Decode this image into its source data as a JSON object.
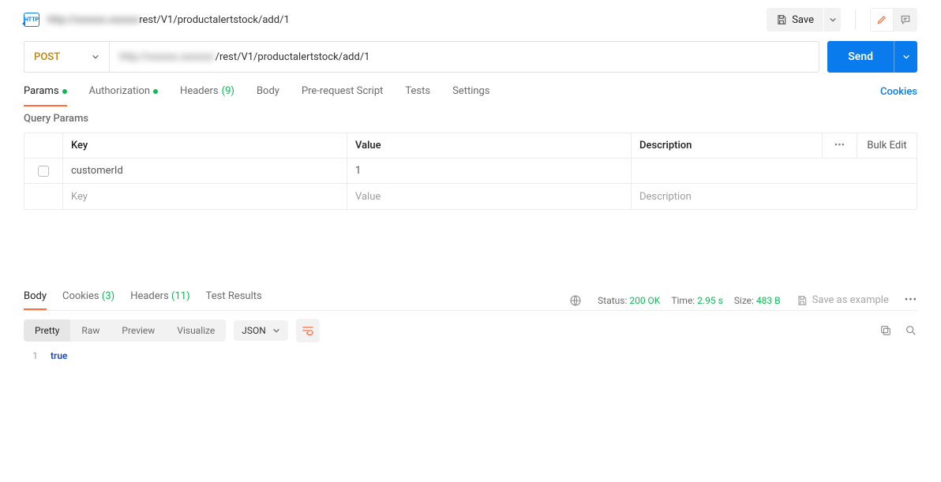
{
  "tab": {
    "badge": "HTTP",
    "host": "http://xxxxxx.xxxxxx",
    "path": "rest/V1/productalertstock/add/1"
  },
  "toolbar": {
    "save_label": "Save"
  },
  "request": {
    "method": "POST",
    "url_host": "http://xxxxxx.xxxxxx/",
    "url_path": "/rest/V1/productalertstock/add/1",
    "send_label": "Send"
  },
  "request_tabs": {
    "params": "Params",
    "authorization": "Authorization",
    "headers_label": "Headers",
    "headers_count": "(9)",
    "body": "Body",
    "prerequest": "Pre-request Script",
    "tests": "Tests",
    "settings": "Settings",
    "cookies": "Cookies"
  },
  "query_params": {
    "title": "Query Params",
    "headers": {
      "key": "Key",
      "value": "Value",
      "description": "Description",
      "bulk": "Bulk Edit"
    },
    "rows": [
      {
        "key": "customerId",
        "value": "1",
        "description": ""
      }
    ],
    "placeholders": {
      "key": "Key",
      "value": "Value",
      "description": "Description"
    }
  },
  "response_tabs": {
    "body": "Body",
    "cookies_label": "Cookies",
    "cookies_count": "(3)",
    "headers_label": "Headers",
    "headers_count": "(11)",
    "test_results": "Test Results"
  },
  "response_meta": {
    "status_label": "Status:",
    "status_value": "200 OK",
    "time_label": "Time:",
    "time_value": "2.95 s",
    "size_label": "Size:",
    "size_value": "483 B",
    "save_example": "Save as example"
  },
  "view_modes": {
    "pretty": "Pretty",
    "raw": "Raw",
    "preview": "Preview",
    "visualize": "Visualize",
    "type": "JSON"
  },
  "response_body": {
    "line1_no": "1",
    "line1_val": "true"
  }
}
